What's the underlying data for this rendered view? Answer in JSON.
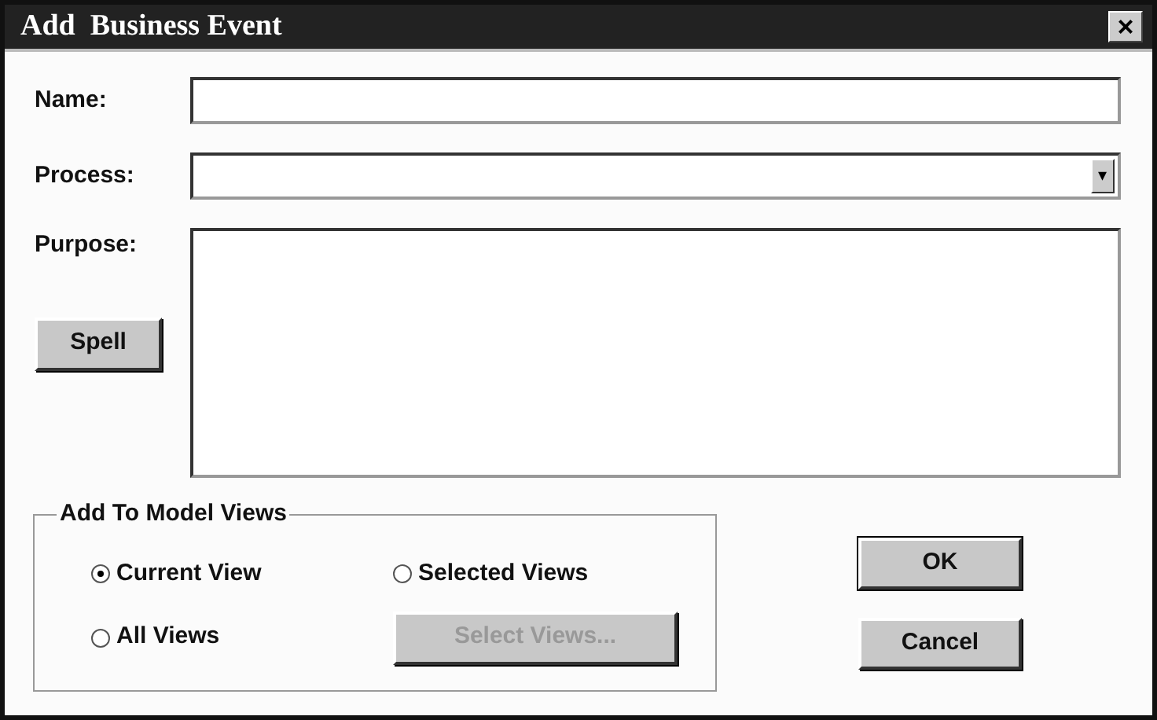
{
  "window": {
    "title": "Add  Business Event",
    "close": "×"
  },
  "fields": [
    {
      "kind": "text",
      "label": "Name:"
    },
    {
      "kind": "combo",
      "label": "Process:",
      "arrow": "▾"
    }
  ],
  "purpose": {
    "label": "Purpose:"
  },
  "spell_button": {
    "label": "Spell"
  },
  "group": {
    "title": "Add To Model Views",
    "options": [
      {
        "label": "Current View",
        "selected": true
      },
      {
        "label": "Selected Views",
        "selected": false
      },
      {
        "label": "All Views",
        "selected": false
      }
    ],
    "select_views_button": {
      "label": "Select Views...",
      "disabled": true
    }
  },
  "buttons": [
    {
      "label": "OK"
    },
    {
      "label": "Cancel"
    }
  ]
}
